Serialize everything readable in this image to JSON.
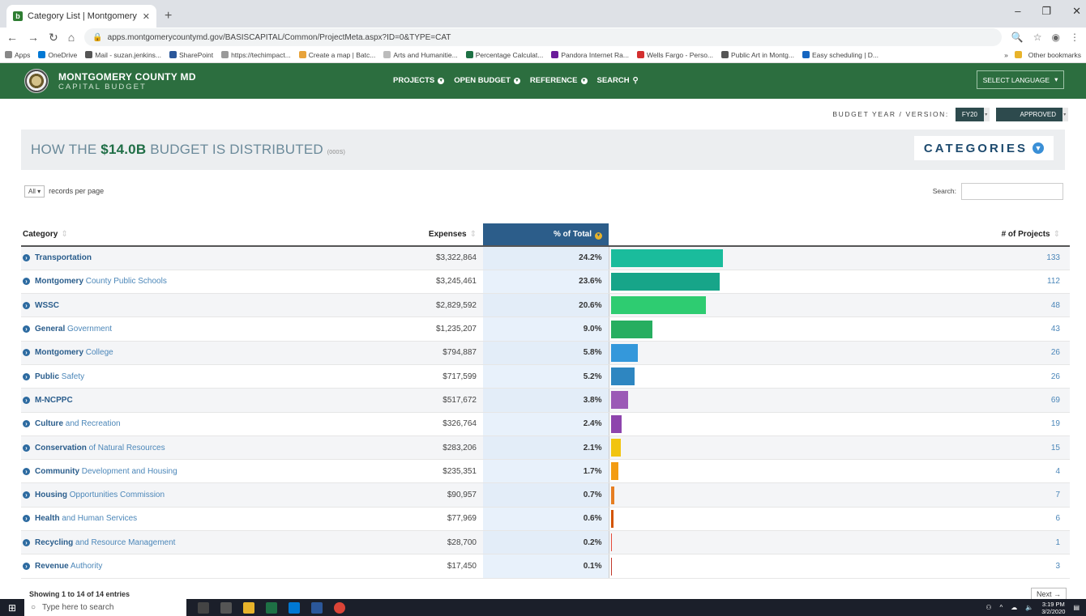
{
  "browser": {
    "tab_title": "Category List | Montgomery Cou",
    "url": "apps.montgomerycountymd.gov/BASISCAPITAL/Common/ProjectMeta.aspx?ID=0&TYPE=CAT",
    "bookmarks": [
      "Apps",
      "OneDrive",
      "Mail - suzan.jenkins...",
      "SharePoint",
      "https://techimpact...",
      "Create a map | Batc...",
      "Arts and Humanitie...",
      "Percentage Calculat...",
      "Pandora Internet Ra...",
      "Wells Fargo - Perso...",
      "Public Art in Montg...",
      "Easy scheduling | D..."
    ],
    "other_bookmarks": "Other bookmarks"
  },
  "header": {
    "title": "MONTGOMERY COUNTY MD",
    "subtitle": "CAPITAL BUDGET",
    "nav": [
      "PROJECTS",
      "OPEN BUDGET",
      "REFERENCE",
      "SEARCH"
    ],
    "language": "SELECT LANGUAGE"
  },
  "budget_year": {
    "label": "BUDGET YEAR / VERSION:",
    "year": "FY20",
    "version": "APPROVED"
  },
  "panel": {
    "title_prefix": "HOW THE ",
    "amount": "$14.0B",
    "title_suffix": " BUDGET IS DISTRIBUTED ",
    "unit": "(000S)",
    "categories_label": "CATEGORIES"
  },
  "controls": {
    "records_value": "All",
    "records_label": "records per page",
    "search_label": "Search:"
  },
  "table": {
    "headers": {
      "category": "Category",
      "expenses": "Expenses",
      "pct": "% of Total",
      "projects": "# of Projects"
    },
    "rows": [
      {
        "bold": "Transportation",
        "rest": "",
        "expenses": "$3,322,864",
        "pct": "24.2%",
        "pct_value": 24.2,
        "color": "#1abc9c",
        "projects": "133"
      },
      {
        "bold": "Montgomery",
        "rest": " County Public Schools",
        "expenses": "$3,245,461",
        "pct": "23.6%",
        "pct_value": 23.6,
        "color": "#17a589",
        "projects": "112"
      },
      {
        "bold": "WSSC",
        "rest": "",
        "expenses": "$2,829,592",
        "pct": "20.6%",
        "pct_value": 20.6,
        "color": "#2ecc71",
        "projects": "48"
      },
      {
        "bold": "General",
        "rest": " Government",
        "expenses": "$1,235,207",
        "pct": "9.0%",
        "pct_value": 9.0,
        "color": "#27ae60",
        "projects": "43"
      },
      {
        "bold": "Montgomery",
        "rest": " College",
        "expenses": "$794,887",
        "pct": "5.8%",
        "pct_value": 5.8,
        "color": "#3498db",
        "projects": "26"
      },
      {
        "bold": "Public",
        "rest": " Safety",
        "expenses": "$717,599",
        "pct": "5.2%",
        "pct_value": 5.2,
        "color": "#2e86c1",
        "projects": "26"
      },
      {
        "bold": "M-NCPPC",
        "rest": "",
        "expenses": "$517,672",
        "pct": "3.8%",
        "pct_value": 3.8,
        "color": "#9b59b6",
        "projects": "69"
      },
      {
        "bold": "Culture",
        "rest": " and Recreation",
        "expenses": "$326,764",
        "pct": "2.4%",
        "pct_value": 2.4,
        "color": "#8e44ad",
        "projects": "19"
      },
      {
        "bold": "Conservation",
        "rest": " of Natural Resources",
        "expenses": "$283,206",
        "pct": "2.1%",
        "pct_value": 2.1,
        "color": "#f1c40f",
        "projects": "15"
      },
      {
        "bold": "Community",
        "rest": " Development and Housing",
        "expenses": "$235,351",
        "pct": "1.7%",
        "pct_value": 1.7,
        "color": "#f39c12",
        "projects": "4"
      },
      {
        "bold": "Housing",
        "rest": " Opportunities Commission",
        "expenses": "$90,957",
        "pct": "0.7%",
        "pct_value": 0.7,
        "color": "#e67e22",
        "projects": "7"
      },
      {
        "bold": "Health",
        "rest": " and Human Services",
        "expenses": "$77,969",
        "pct": "0.6%",
        "pct_value": 0.6,
        "color": "#d35400",
        "projects": "6"
      },
      {
        "bold": "Recycling",
        "rest": " and Resource Management",
        "expenses": "$28,700",
        "pct": "0.2%",
        "pct_value": 0.2,
        "color": "#e74c3c",
        "projects": "1"
      },
      {
        "bold": "Revenue",
        "rest": " Authority",
        "expenses": "$17,450",
        "pct": "0.1%",
        "pct_value": 0.1,
        "color": "#c0392b",
        "projects": "3"
      }
    ],
    "footer": "Showing 1 to 14 of 14 entries",
    "next": "Next →"
  },
  "taskbar": {
    "search_placeholder": "Type here to search",
    "time": "3:19 PM",
    "date": "3/2/2020"
  }
}
